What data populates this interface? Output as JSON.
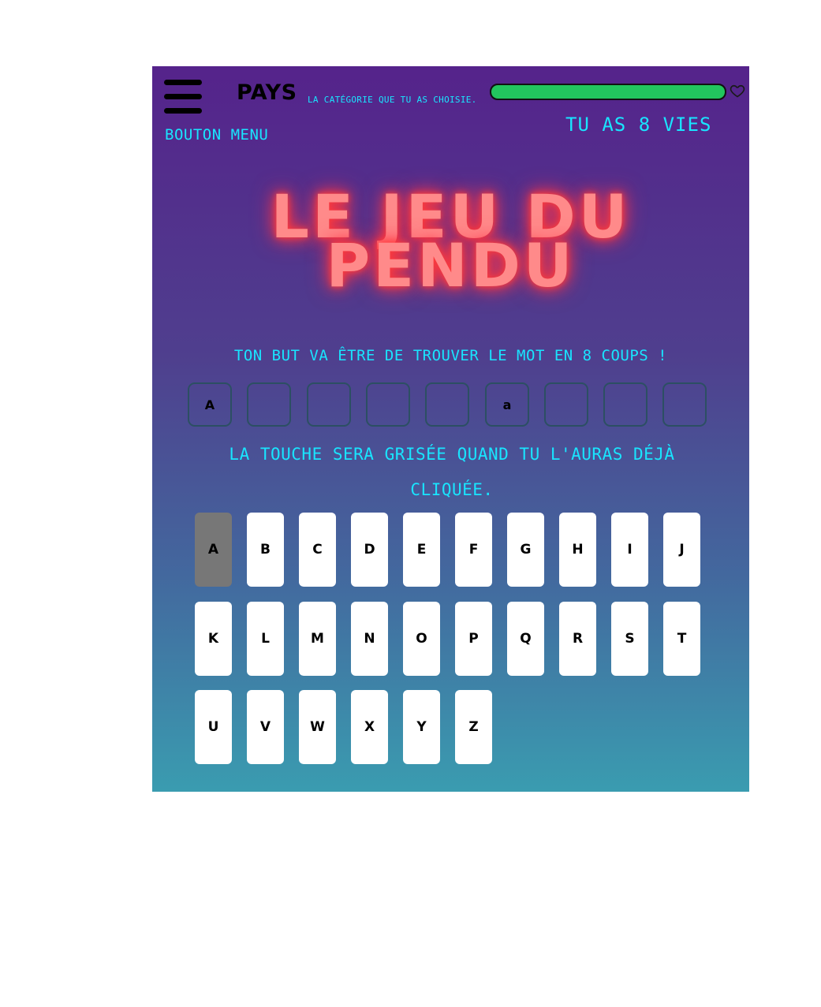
{
  "header": {
    "menu_label": "BOUTON MENU",
    "category": "PAYS",
    "category_hint": "LA CATÉGORIE QUE TU AS CHOISIE.",
    "lives_text": "TU AS 8 VIES",
    "life_fraction": 1.0,
    "life_color": "#22c55e",
    "heart_icon": "heart-outline-icon"
  },
  "title": {
    "line1": "LE JEU DU",
    "line2": "PENDU"
  },
  "goal_text": "TON BUT VA ÊTRE DE TROUVER LE MOT EN 8 COUPS !",
  "word_slots": [
    "A",
    "",
    "",
    "",
    "",
    "a",
    "",
    "",
    ""
  ],
  "hint_text": "LA TOUCHE SERA GRISÉE QUAND TU L'AURAS DÉJÀ CLIQUÉE.",
  "keyboard": {
    "keys": [
      "A",
      "B",
      "C",
      "D",
      "E",
      "F",
      "G",
      "H",
      "I",
      "J",
      "K",
      "L",
      "M",
      "N",
      "O",
      "P",
      "Q",
      "R",
      "S",
      "T",
      "U",
      "V",
      "W",
      "X",
      "Y",
      "Z"
    ],
    "used": [
      "A"
    ]
  },
  "colors": {
    "accent_text": "#19e5ff",
    "title_glow": "#ff8a8a",
    "key_used": "#777777"
  }
}
